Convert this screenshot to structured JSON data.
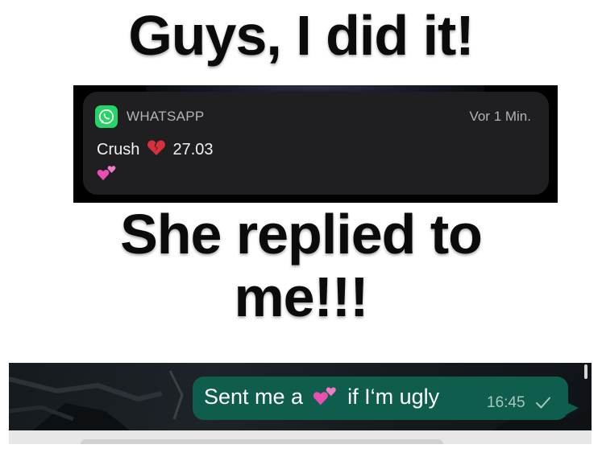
{
  "captions": {
    "top": "Guys, I did it!",
    "middle_line1": "She replied to",
    "middle_line2": "me!!!"
  },
  "notification": {
    "app_name": "WHATSAPP",
    "time": "Vor 1 Min.",
    "sender": "Crush",
    "sender_emoji": "broken-heart-icon",
    "preview_text": "27.03",
    "second_line_emoji": "two-hearts-icon",
    "brand_color": "#25d366"
  },
  "chat": {
    "message_prefix": "Sent me a",
    "message_emoji": "two-hearts-icon",
    "message_suffix": "if I‘m ugly",
    "time": "16:45",
    "status_icon": "single-check-icon",
    "bubble_color": "#0f5e4d"
  }
}
